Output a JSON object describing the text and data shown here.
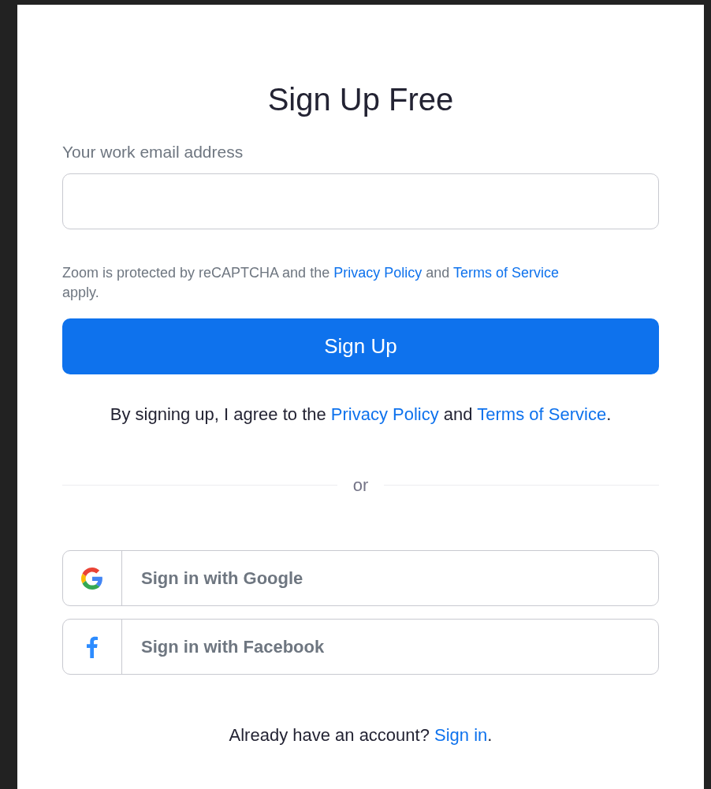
{
  "title": "Sign Up Free",
  "email_field": {
    "label": "Your work email address"
  },
  "recaptcha_notice": [
    {
      "kind": "text",
      "text": "Zoom is protected by reCAPTCHA and the "
    },
    {
      "kind": "link",
      "text": "Privacy Policy"
    },
    {
      "kind": "text",
      "text": " and "
    },
    {
      "kind": "link",
      "text": "Terms of Service"
    },
    {
      "kind": "text",
      "text": " apply."
    }
  ],
  "submit_button": "Sign Up",
  "agreement": [
    {
      "kind": "text",
      "text": "By signing up, I agree to the "
    },
    {
      "kind": "link",
      "text": "Privacy Policy"
    },
    {
      "kind": "text",
      "text": " and "
    },
    {
      "kind": "link",
      "text": "Terms of Service"
    },
    {
      "kind": "text",
      "text": "."
    }
  ],
  "divider_text": "or",
  "social_buttons": [
    {
      "kind": "google",
      "label": "Sign in with Google"
    },
    {
      "kind": "facebook",
      "label": "Sign in with Facebook"
    }
  ],
  "footer": [
    {
      "kind": "text",
      "text": "Already have an account? "
    },
    {
      "kind": "link",
      "text": "Sign in"
    },
    {
      "kind": "text",
      "text": "."
    }
  ]
}
